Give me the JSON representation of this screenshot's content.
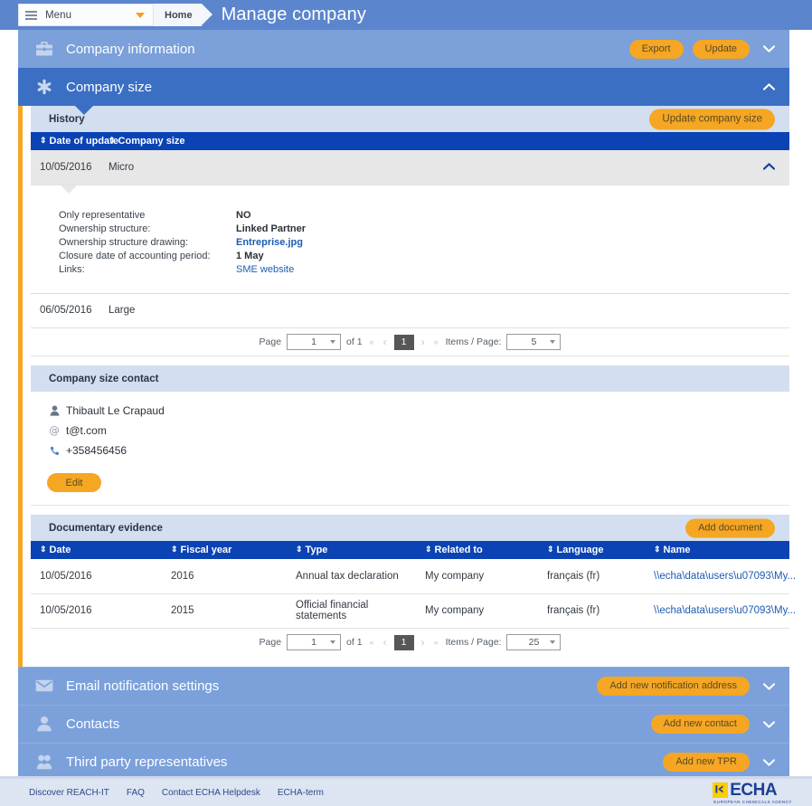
{
  "topbar": {
    "menu_label": "Menu",
    "home_label": "Home",
    "page_title": "Manage company",
    "menu_icon": "hamburger-icon",
    "caret_icon": "caret-down-icon"
  },
  "sections": {
    "company_information": {
      "title": "Company information",
      "icon": "briefcase-icon",
      "export_label": "Export",
      "update_label": "Update",
      "chevron": "chevron-down-icon"
    },
    "company_size": {
      "title": "Company size",
      "icon": "asterisk-icon",
      "chevron": "chevron-up-icon"
    },
    "email_notification_settings": {
      "title": "Email notification settings",
      "icon": "envelope-icon",
      "button_label": "Add new notification address",
      "chevron": "chevron-down-icon"
    },
    "contacts": {
      "title": "Contacts",
      "icon": "user-icon",
      "button_label": "Add new contact",
      "chevron": "chevron-down-icon"
    },
    "third_party_representatives": {
      "title": "Third party representatives",
      "icon": "tpr-icon",
      "button_label": "Add new TPR",
      "chevron": "chevron-down-icon"
    }
  },
  "history": {
    "title": "History",
    "update_button": "Update company size",
    "columns": [
      "Date of update",
      "Company size"
    ],
    "rows": [
      {
        "date": "10/05/2016",
        "size": "Micro",
        "expanded": true
      },
      {
        "date": "06/05/2016",
        "size": "Large",
        "expanded": false
      }
    ],
    "detail": {
      "fields": [
        {
          "key": "Only representative",
          "value": "NO",
          "type": "text"
        },
        {
          "key": "Ownership structure:",
          "value": "Linked Partner",
          "type": "text"
        },
        {
          "key": "Ownership structure drawing:",
          "value": "Entreprise.jpg",
          "type": "link"
        },
        {
          "key": "Closure date of accounting period:",
          "value": "1 May",
          "type": "text"
        },
        {
          "key": "Links:",
          "value": "SME website",
          "type": "link-normal"
        }
      ]
    },
    "pager": {
      "page_label": "Page",
      "page_value": "1",
      "of_label": "of 1",
      "current": "1",
      "items_label": "Items / Page:",
      "items_value": "5"
    }
  },
  "company_size_contact": {
    "title": "Company size contact",
    "name": "Thibault Le Crapaud",
    "email": "t@t.com",
    "phone": "+358456456",
    "edit_label": "Edit",
    "name_icon": "user-icon",
    "email_icon": "at-icon",
    "phone_icon": "phone-icon"
  },
  "documentary_evidence": {
    "title": "Documentary evidence",
    "add_button": "Add document",
    "columns": [
      "Date",
      "Fiscal year",
      "Type",
      "Related to",
      "Language",
      "Name"
    ],
    "rows": [
      {
        "date": "10/05/2016",
        "fiscal_year": "2016",
        "type": "Annual tax declaration",
        "related_to": "My company",
        "language": "français (fr)",
        "name": "\\\\echa\\data\\users\\u07093\\My..."
      },
      {
        "date": "10/05/2016",
        "fiscal_year": "2015",
        "type": "Official financial statements",
        "related_to": "My company",
        "language": "français (fr)",
        "name": "\\\\echa\\data\\users\\u07093\\My..."
      }
    ],
    "pager": {
      "page_label": "Page",
      "page_value": "1",
      "of_label": "of 1",
      "current": "1",
      "items_label": "Items / Page:",
      "items_value": "25"
    }
  },
  "footer": {
    "links": [
      "Discover REACH-IT",
      "FAQ",
      "Contact ECHA Helpdesk",
      "ECHA-term"
    ],
    "logo_text": "ECHA",
    "logo_subtitle": "EUROPEAN CHEMICALS AGENCY"
  },
  "colors": {
    "topbar": "#5b86ce",
    "accordion_light": "#7ba0da",
    "accordion_dark": "#3b6fc4",
    "orange": "#f5a623",
    "table_header": "#0b43b4",
    "subheader": "#d3dff0",
    "footer": "#dde5f2",
    "link": "#1c5cb3"
  }
}
